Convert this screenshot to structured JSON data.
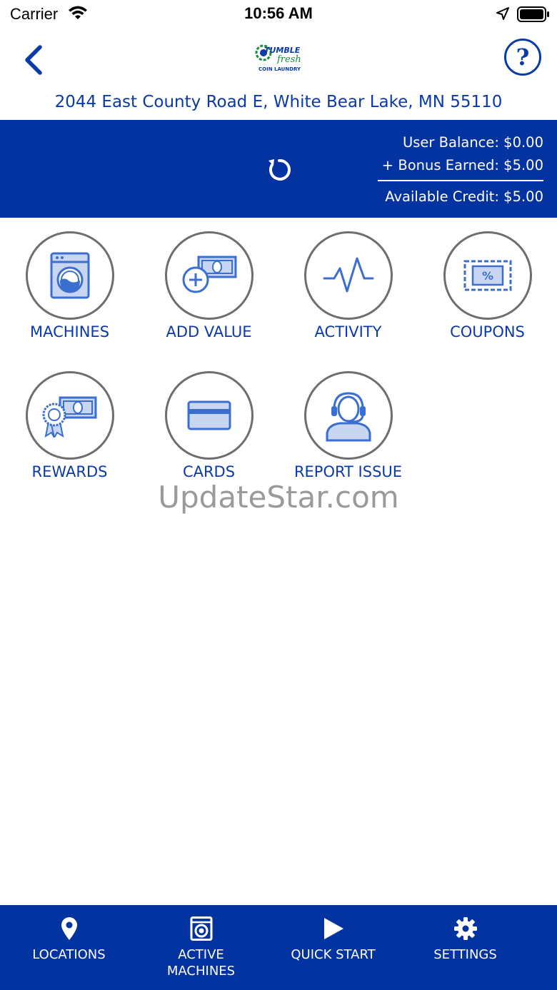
{
  "status_bar": {
    "carrier": "Carrier",
    "time": "10:56 AM",
    "icons": [
      "wifi-icon",
      "location-arrow-icon",
      "battery-icon"
    ]
  },
  "header": {
    "back_icon": "chevron-left-icon",
    "logo": {
      "line1": "TUMBLE",
      "line2": "fresh",
      "line3": "COIN LAUNDRY"
    },
    "help_label": "?",
    "address": "2044 East County Road E, White Bear Lake, MN 55110"
  },
  "balance": {
    "refresh_icon": "refresh-icon",
    "user_balance": "User Balance: $0.00",
    "bonus_earned": "+ Bonus Earned: $5.00",
    "available_credit": "Available Credit: $5.00"
  },
  "menu": [
    {
      "label": "MACHINES",
      "icon": "washer-icon"
    },
    {
      "label": "ADD VALUE",
      "icon": "add-money-icon"
    },
    {
      "label": "ACTIVITY",
      "icon": "pulse-icon"
    },
    {
      "label": "COUPONS",
      "icon": "coupon-icon"
    },
    {
      "label": "REWARDS",
      "icon": "reward-ribbon-icon"
    },
    {
      "label": "CARDS",
      "icon": "credit-card-icon"
    },
    {
      "label": "REPORT ISSUE",
      "icon": "headset-agent-icon"
    }
  ],
  "watermark": "UpdateStar.com",
  "tabbar": [
    {
      "label": "LOCATIONS",
      "icon": "map-pin-icon"
    },
    {
      "label": "ACTIVE\nMACHINES",
      "icon": "washer-icon"
    },
    {
      "label": "QUICK START",
      "icon": "play-icon"
    },
    {
      "label": "SETTINGS",
      "icon": "gear-icon"
    }
  ],
  "colors": {
    "brand_blue": "#0333a1",
    "text_blue": "#0a3aa8",
    "icon_blue": "#3a6fd0",
    "icon_fill": "#c9d6f2",
    "circle_gray": "#6e6e6e"
  }
}
